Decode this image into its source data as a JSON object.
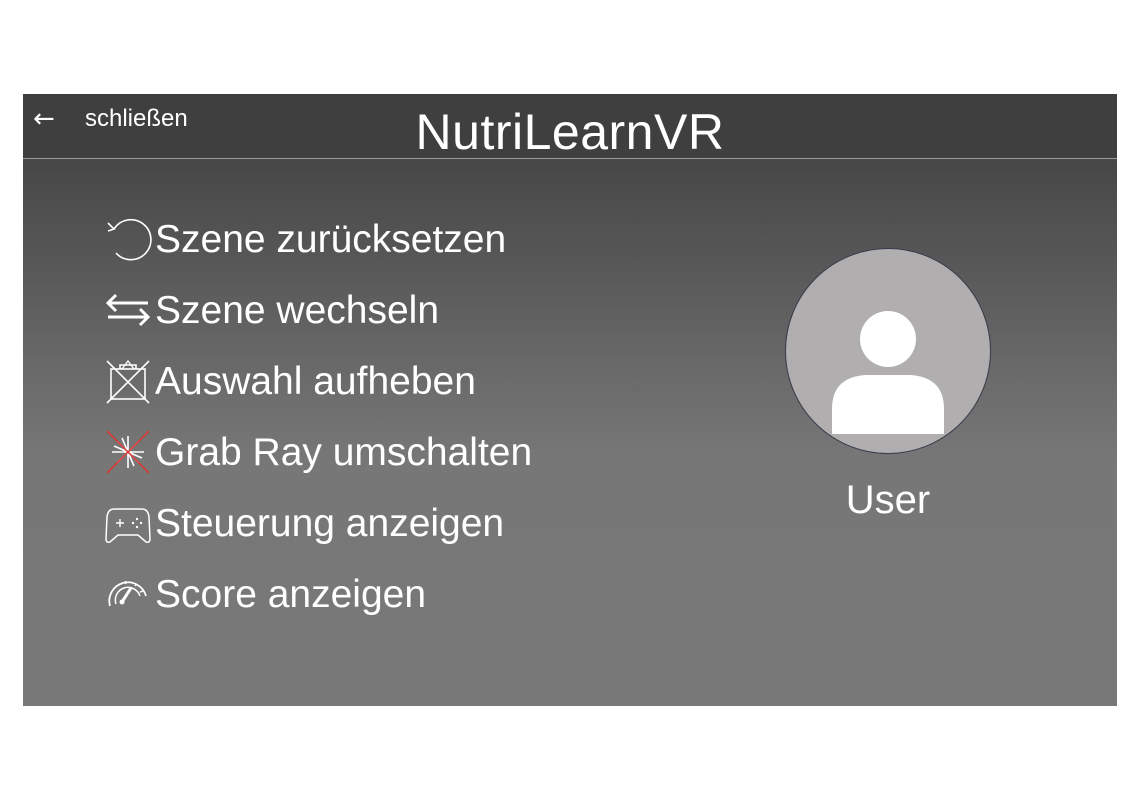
{
  "header": {
    "back_arrow": "←",
    "close_label": "schließen",
    "title": "NutriLearnVR"
  },
  "menu": {
    "items": [
      {
        "icon": "reset-icon",
        "label": "Szene zurücksetzen"
      },
      {
        "icon": "swap-arrows-icon",
        "label": "Szene wechseln"
      },
      {
        "icon": "deselect-icon",
        "label": "Auswahl aufheben"
      },
      {
        "icon": "grab-ray-icon",
        "label": "Grab Ray umschalten"
      },
      {
        "icon": "gamepad-icon",
        "label": "Steuerung anzeigen"
      },
      {
        "icon": "speedometer-icon",
        "label": "Score anzeigen"
      }
    ]
  },
  "user": {
    "label": "User",
    "avatar_icon": "user-avatar-icon"
  },
  "colors": {
    "header_bg": "#3f3f3f",
    "panel_bg_top": "#3d3d3d",
    "panel_bg_bottom": "#787878",
    "avatar_bg": "#b0aeae",
    "grab_ray_accent": "#d43a3a",
    "text": "#ffffff"
  }
}
